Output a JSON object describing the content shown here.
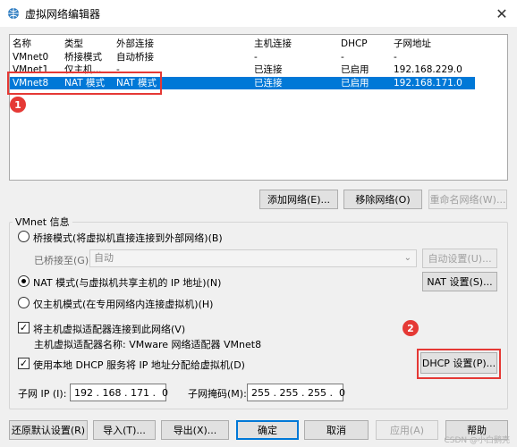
{
  "window": {
    "title": "虚拟网络编辑器"
  },
  "table": {
    "columns": [
      "名称",
      "类型",
      "外部连接",
      "主机连接",
      "DHCP",
      "子网地址"
    ],
    "rows": [
      [
        "VMnet0",
        "桥接模式",
        "自动桥接",
        "-",
        "-",
        "-"
      ],
      [
        "VMnet1",
        "仅主机...",
        "-",
        "已连接",
        "已启用",
        "192.168.229.0"
      ],
      [
        "VMnet8",
        "NAT 模式",
        "NAT 模式",
        "已连接",
        "已启用",
        "192.168.171.0"
      ]
    ]
  },
  "annotations": {
    "badge1": "1",
    "badge2": "2"
  },
  "list_buttons": {
    "add": "添加网络(E)...",
    "remove": "移除网络(O)",
    "rename": "重命名网络(W)..."
  },
  "vmnet_info": {
    "title": "VMnet 信息",
    "bridged_label": "桥接模式(将虚拟机直接连接到外部网络)(B)",
    "bridged_to_label": "已桥接至(G):",
    "bridged_to_value": "自动",
    "auto_settings": "自动设置(U)...",
    "nat_label": "NAT 模式(与虚拟机共享主机的 IP 地址)(N)",
    "nat_settings": "NAT 设置(S)...",
    "hostonly_label": "仅主机模式(在专用网络内连接虚拟机)(H)",
    "connect_adapter_label": "将主机虚拟适配器连接到此网络(V)",
    "adapter_name_label": "主机虚拟适配器名称: VMware 网络适配器 VMnet8",
    "dhcp_label": "使用本地 DHCP 服务将 IP 地址分配给虚拟机(D)",
    "dhcp_settings": "DHCP 设置(P)...",
    "subnet_ip_label": "子网 IP (I):",
    "subnet_ip_value": "192 . 168 . 171 .  0",
    "subnet_mask_label": "子网掩码(M):",
    "subnet_mask_value": "255 . 255 . 255 .  0"
  },
  "bottom_buttons": {
    "restore": "还原默认设置(R)",
    "import": "导入(T)...",
    "export": "导出(X)...",
    "ok": "确定",
    "cancel": "取消",
    "apply": "应用(A)",
    "help": "帮助"
  },
  "watermark": "CSDN @小白鹅壳"
}
